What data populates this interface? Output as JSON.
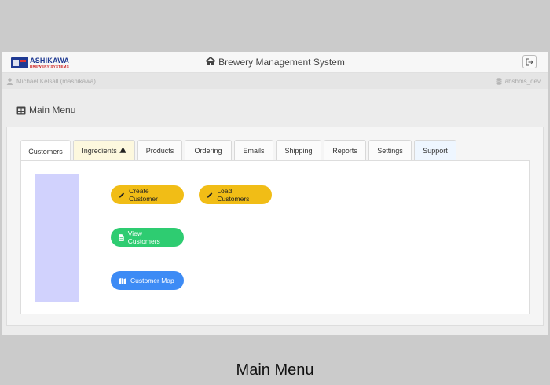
{
  "brand": {
    "name": "ASHIKAWA",
    "tagline": "BREWERY SYSTEMS"
  },
  "header": {
    "title": "Brewery Management System"
  },
  "userbar": {
    "user": "Michael Kelsall (mashikawa)",
    "database": "absbms_dev"
  },
  "page": {
    "title": "Main Menu"
  },
  "tabs": [
    {
      "label": "Customers"
    },
    {
      "label": "Ingredients"
    },
    {
      "label": "Products"
    },
    {
      "label": "Ordering"
    },
    {
      "label": "Emails"
    },
    {
      "label": "Shipping"
    },
    {
      "label": "Reports"
    },
    {
      "label": "Settings"
    },
    {
      "label": "Support"
    }
  ],
  "actions": {
    "create_customer": "Create Customer",
    "load_customers": "Load Customers",
    "view_customers": "View Customers",
    "customer_map": "Customer Map"
  },
  "colors": {
    "brand": "#1f3a93",
    "yellow": "#f1bd16",
    "green": "#2ecc71",
    "blue": "#3d8bf5",
    "sidebox": "#d1d2fd"
  },
  "caption": "Main Menu"
}
